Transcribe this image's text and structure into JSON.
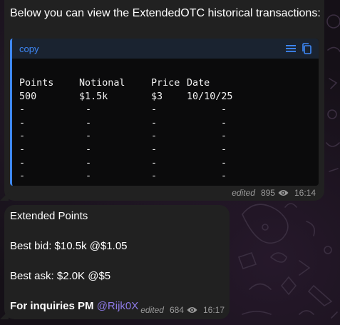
{
  "colors": {
    "bubble": "#212121",
    "accent": "#3e88f7",
    "mention": "#8d7ae6",
    "code_bg": "#0b0b0c",
    "meta_text": "#9a9a9a"
  },
  "message1": {
    "intro": "Below you can view the ExtendedOTC historical transactions:",
    "code": {
      "language_label": "copy",
      "icons": [
        "menu-icon",
        "copy-icon"
      ],
      "headers": [
        "Points",
        "Notional",
        "Price",
        "Date"
      ],
      "rows": [
        [
          "500",
          "$1.5k",
          "$3",
          "10/10/25"
        ],
        [
          "-",
          "-",
          "-",
          "-"
        ],
        [
          "-",
          "-",
          "-",
          "-"
        ],
        [
          "-",
          "-",
          "-",
          "-"
        ],
        [
          "-",
          "-",
          "-",
          "-"
        ],
        [
          "-",
          "-",
          "-",
          "-"
        ],
        [
          "-",
          "-",
          "-",
          "-"
        ]
      ]
    },
    "edited": "edited",
    "views": "895",
    "time": "16:14"
  },
  "message2": {
    "title": "Extended Points",
    "best_bid": "Best bid: $10.5k @$1.05",
    "best_ask": "Best ask: $2.0K @$5",
    "inquiries": "For inquiries PM",
    "mention": "@Rijk0X",
    "edited": "edited",
    "views": "684",
    "time": "16:17"
  }
}
